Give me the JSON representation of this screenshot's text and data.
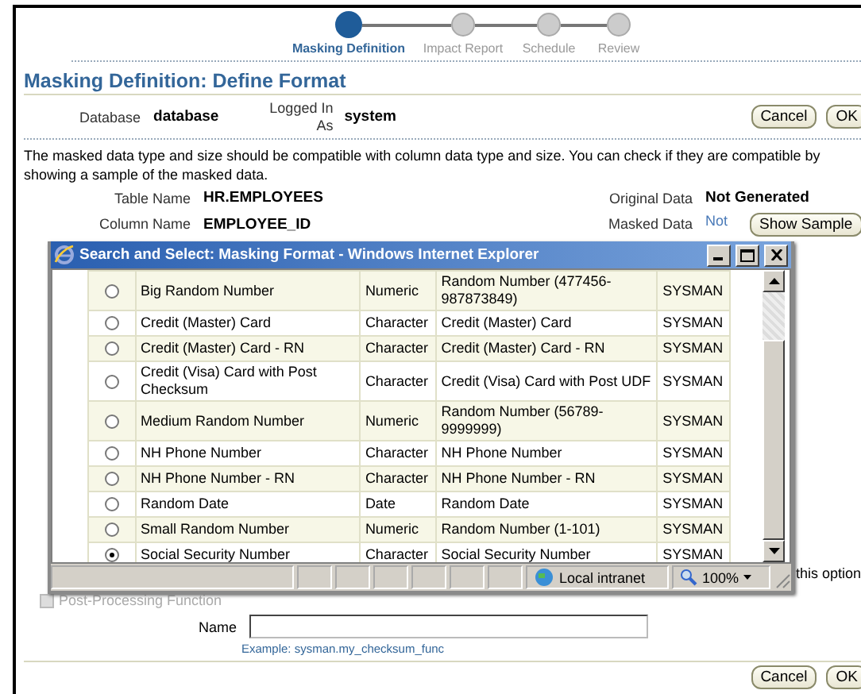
{
  "train": [
    {
      "label": "Masking Definition",
      "selected": true
    },
    {
      "label": "Impact Report",
      "selected": false
    },
    {
      "label": "Schedule",
      "selected": false
    },
    {
      "label": "Review",
      "selected": false
    }
  ],
  "title": "Masking Definition: Define Format",
  "context": {
    "database_label": "Database",
    "database": "database",
    "user_label": "Logged In As",
    "user": "system"
  },
  "top_buttons": [
    "Cancel",
    "OK"
  ],
  "instruction": "The masked data type and size should be compatible with column data type and size. You can check if they are compatible by showing a sample of the masked data.",
  "fields": [
    {
      "label": "Table Name",
      "value": "HR.EMPLOYEES"
    },
    {
      "label": "Column Name",
      "value": "EMPLOYEE_ID"
    }
  ],
  "samples": [
    {
      "label": "Original Data",
      "value": "Not Generated"
    },
    {
      "label": "Masked Data",
      "value": "Not"
    }
  ],
  "show_sample_button": "Show Sample",
  "popup": {
    "title": "Search and Select: Masking Format - Windows Internet Explorer",
    "rows": [
      {
        "name": "Big Random Number",
        "type": "Numeric",
        "format": "Random Number (477456-987873849)",
        "owner": "SYSMAN",
        "selected": false
      },
      {
        "name": "Credit (Master) Card",
        "type": "Character",
        "format": "Credit (Master) Card",
        "owner": "SYSMAN",
        "selected": false
      },
      {
        "name": "Credit (Master) Card - RN",
        "type": "Character",
        "format": "Credit (Master) Card - RN",
        "owner": "SYSMAN",
        "selected": false
      },
      {
        "name": "Credit (Visa) Card with Post Checksum",
        "type": "Character",
        "format": "Credit (Visa) Card with Post UDF",
        "owner": "SYSMAN",
        "selected": false
      },
      {
        "name": "Medium Random Number",
        "type": "Numeric",
        "format": "Random Number (56789-9999999)",
        "owner": "SYSMAN",
        "selected": false
      },
      {
        "name": "NH Phone Number",
        "type": "Character",
        "format": "NH Phone Number",
        "owner": "SYSMAN",
        "selected": false
      },
      {
        "name": "NH Phone Number - RN",
        "type": "Character",
        "format": "NH Phone Number - RN",
        "owner": "SYSMAN",
        "selected": false
      },
      {
        "name": "Random Date",
        "type": "Date",
        "format": "Random Date",
        "owner": "SYSMAN",
        "selected": false
      },
      {
        "name": "Small Random Number",
        "type": "Numeric",
        "format": "Random Number (1-101)",
        "owner": "SYSMAN",
        "selected": false
      },
      {
        "name": "Social Security Number",
        "type": "Character",
        "format": "Social Security Number",
        "owner": "SYSMAN",
        "selected": true
      }
    ],
    "status_zone": "Local intranet",
    "zoom": "100%"
  },
  "behind_text": "this option",
  "post_processing": {
    "label": "Post-Processing Function",
    "checked": false,
    "disabled": true
  },
  "name_field": {
    "label": "Name",
    "hint": "Example: sysman.my_checksum_func"
  },
  "bottom_buttons": [
    "Cancel",
    "OK"
  ]
}
